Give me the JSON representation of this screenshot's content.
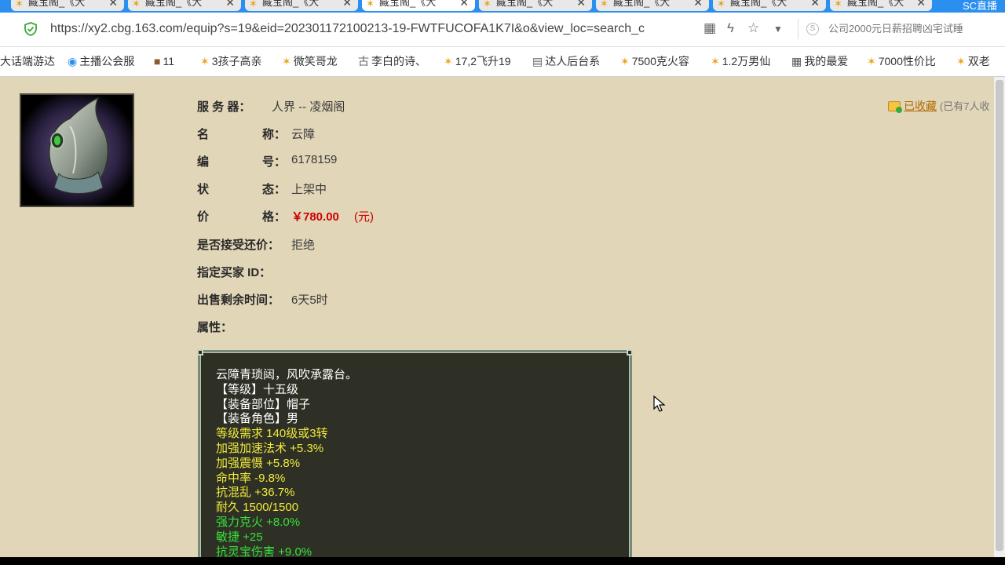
{
  "browser": {
    "tabs": [
      {
        "label": "藏宝阁_《大"
      },
      {
        "label": "藏宝阁_《大"
      },
      {
        "label": "藏宝阁_《大"
      },
      {
        "label": "藏宝阁_《大"
      },
      {
        "label": "藏宝阁_《大"
      },
      {
        "label": "藏宝阁_《大"
      },
      {
        "label": "藏宝阁_《大"
      },
      {
        "label": "藏宝阁_《大"
      }
    ],
    "brand_text": "SC直播",
    "url": "https://xy2.cbg.163.com/equip?s=19&eid=202301172100213-19-FWTFUCOFA1K7I&o&view_loc=search_c",
    "search_placeholder": "公司2000元日薪招聘凶宅试睡",
    "bookmarks": [
      {
        "label": "大话端游达",
        "icon": "none"
      },
      {
        "label": "主播公会服",
        "icon": "ie-icon"
      },
      {
        "label": "11",
        "icon": "game-icon"
      },
      {
        "label": "3孩子高亲",
        "icon": "star-icon"
      },
      {
        "label": "微笑哥龙",
        "icon": "star-icon"
      },
      {
        "label": "李白的诗、",
        "icon": "poem-icon"
      },
      {
        "label": "17,2飞升19",
        "icon": "star-icon"
      },
      {
        "label": "达人后台系",
        "icon": "doc-icon"
      },
      {
        "label": "7500克火容",
        "icon": "star-icon"
      },
      {
        "label": "1.2万男仙",
        "icon": "star-icon"
      },
      {
        "label": "我的最爱",
        "icon": "grid-icon"
      },
      {
        "label": "7000性价比",
        "icon": "star-icon"
      },
      {
        "label": "双老",
        "icon": "star-icon"
      }
    ]
  },
  "item": {
    "server_label": "服 务 器：",
    "server_value": "人界 -- 凌烟阁",
    "name_label_1": "名",
    "name_label_2": "称：",
    "name_value": "云障",
    "id_label_1": "编",
    "id_label_2": "号：",
    "id_value": "6178159",
    "status_label_1": "状",
    "status_label_2": "态：",
    "status_value": "上架中",
    "price_label_1": "价",
    "price_label_2": "格：",
    "price_value": "￥780.00",
    "price_unit": "(元)",
    "bargain_label": "是否接受还价：",
    "bargain_value": "拒绝",
    "buyer_label": "指定买家 ID：",
    "time_label": "出售剩余时间：",
    "time_value": "6天5时",
    "attr_label": "属性："
  },
  "favorite": {
    "link": "已收藏",
    "count": "(已有7人收"
  },
  "attributes": [
    {
      "text": "云障青琐闼，风吹承露台。",
      "color": "white"
    },
    {
      "text": "【等级】十五级",
      "color": "white"
    },
    {
      "text": "【装备部位】帽子",
      "color": "white"
    },
    {
      "text": "【装备角色】男",
      "color": "white"
    },
    {
      "text": "等级需求 140级或3转",
      "color": "yellow"
    },
    {
      "text": "加强加速法术 +5.3%",
      "color": "yellow"
    },
    {
      "text": "加强震慑 +5.8%",
      "color": "yellow"
    },
    {
      "text": "命中率 -9.8%",
      "color": "yellow"
    },
    {
      "text": "抗混乱 +36.7%",
      "color": "yellow"
    },
    {
      "text": "耐久 1500/1500",
      "color": "yellow"
    },
    {
      "text": "强力克火 +8.0%",
      "color": "green"
    },
    {
      "text": "敏捷 +25",
      "color": "green"
    },
    {
      "text": "抗灵宝伤害 +9.0%",
      "color": "green"
    }
  ]
}
